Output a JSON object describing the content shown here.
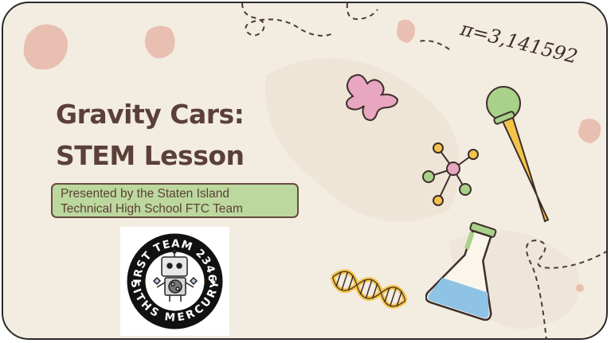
{
  "slide": {
    "title_line1": "Gravity Cars:",
    "title_line2": "STEM Lesson",
    "subtitle_line1": "Presented by the Staten Island",
    "subtitle_line2": "Technical High School FTC Team",
    "pi_formula": "π=3,141592",
    "logo": {
      "top_text": "FIRST TEAM 23463",
      "bottom_text": "SITHS MERCURY"
    }
  },
  "colors": {
    "background": "#f3ece0",
    "title_text": "#5b4037",
    "subtitle_box": "#bcd89e",
    "blob_pink": "#e8bfb0",
    "splat_pink": "#e8a6c0",
    "green": "#a8d18a",
    "flask_liquid": "#8fc3e6",
    "dna_yellow": "#f4c44a"
  },
  "icons": [
    "pink-splat-icon",
    "molecule-icon",
    "dropper-icon",
    "flask-icon",
    "dna-icon",
    "robot-mascot-icon"
  ]
}
